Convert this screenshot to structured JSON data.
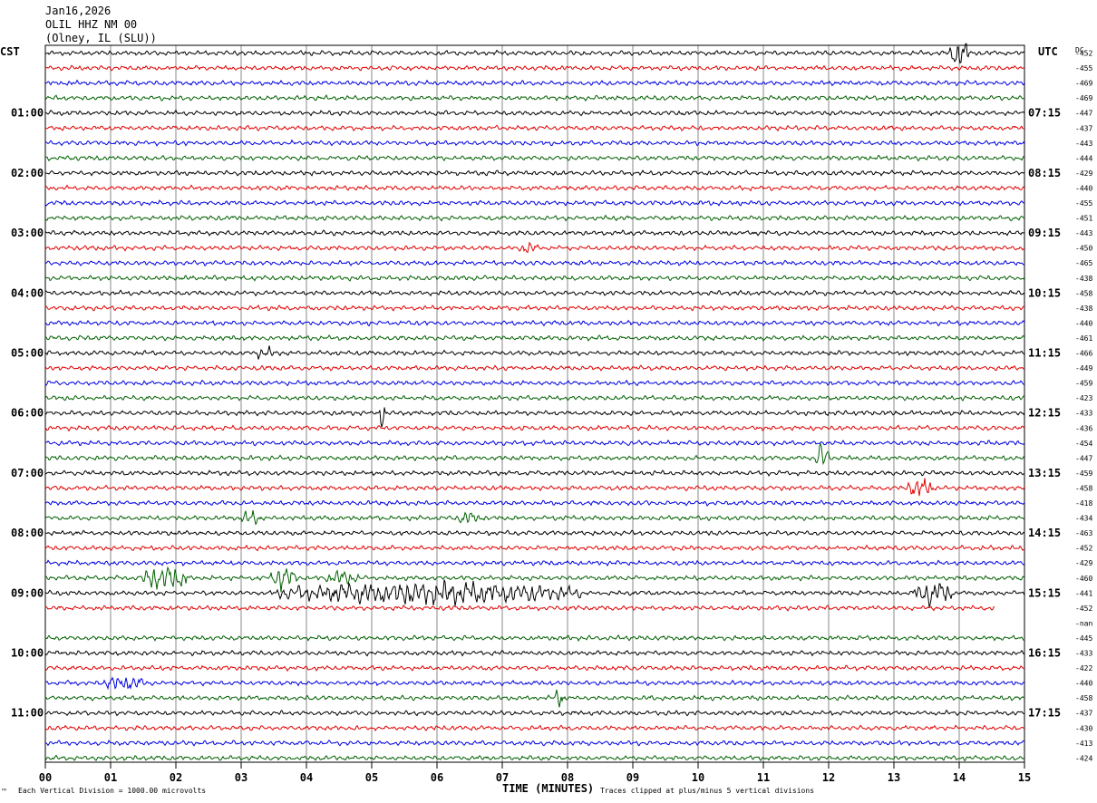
{
  "header": {
    "date": "Jan16,2026",
    "station": "OLIL HHZ NM 00",
    "location": "(Olney, IL (SLU))",
    "left_zone": "CST",
    "right_zone": "UTC",
    "dc_label": "DC"
  },
  "chart_data": {
    "type": "line",
    "title": "",
    "xlabel": "TIME (MINUTES)",
    "x_ticks": [
      "00",
      "01",
      "02",
      "03",
      "04",
      "05",
      "06",
      "07",
      "08",
      "09",
      "10",
      "11",
      "12",
      "13",
      "14",
      "15"
    ],
    "xlim": [
      0,
      15
    ],
    "trace_colors": [
      "#000000",
      "#e00000",
      "#0000e0",
      "#006000"
    ],
    "left_time_labels": [
      "01:00",
      "02:00",
      "03:00",
      "04:00",
      "05:00",
      "06:00",
      "07:00",
      "08:00",
      "09:00",
      "10:00",
      "11:00"
    ],
    "right_time_labels": [
      "07:15",
      "08:15",
      "09:15",
      "10:15",
      "11:15",
      "12:15",
      "13:15",
      "14:15",
      "15:15",
      "16:15",
      "17:15"
    ],
    "dc_offsets": [
      "-452",
      "-455",
      "-469",
      "-469",
      "-447",
      "-437",
      "-443",
      "-444",
      "-429",
      "-440",
      "-455",
      "-451",
      "-443",
      "-450",
      "-465",
      "-438",
      "-458",
      "-438",
      "-440",
      "-461",
      "-466",
      "-449",
      "-459",
      "-423",
      "-433",
      "-436",
      "-454",
      "-447",
      "-459",
      "-458",
      "-418",
      "-434",
      "-463",
      "-452",
      "-429",
      "-460",
      "-441",
      "-452",
      "-nan",
      "-445",
      "-433",
      "-422",
      "-440",
      "-458",
      "-437",
      "-430",
      "-413",
      "-424"
    ],
    "events": [
      {
        "row": 0,
        "start_min": 13.85,
        "end_min": 14.15,
        "amp": 3.0
      },
      {
        "row": 13,
        "start_min": 7.25,
        "end_min": 7.55,
        "amp": 1.3
      },
      {
        "row": 20,
        "start_min": 3.2,
        "end_min": 3.5,
        "amp": 1.4
      },
      {
        "row": 24,
        "start_min": 5.1,
        "end_min": 5.2,
        "amp": 3.4
      },
      {
        "row": 27,
        "start_min": 11.8,
        "end_min": 12.0,
        "amp": 3.4
      },
      {
        "row": 29,
        "start_min": 13.2,
        "end_min": 13.6,
        "amp": 2.2
      },
      {
        "row": 31,
        "start_min": 3.0,
        "end_min": 3.3,
        "amp": 1.4
      },
      {
        "row": 31,
        "start_min": 6.3,
        "end_min": 6.7,
        "amp": 1.3
      },
      {
        "row": 35,
        "start_min": 1.5,
        "end_min": 2.2,
        "amp": 2.5
      },
      {
        "row": 35,
        "start_min": 3.45,
        "end_min": 3.85,
        "amp": 2.5
      },
      {
        "row": 35,
        "start_min": 4.3,
        "end_min": 4.8,
        "amp": 1.5
      },
      {
        "row": 36,
        "start_min": 3.55,
        "end_min": 8.2,
        "amp": 2.2
      },
      {
        "row": 36,
        "start_min": 13.3,
        "end_min": 13.9,
        "amp": 2.6
      },
      {
        "row": 42,
        "start_min": 0.9,
        "end_min": 1.5,
        "amp": 1.6
      },
      {
        "row": 43,
        "start_min": 7.8,
        "end_min": 7.95,
        "amp": 2.0
      }
    ],
    "truncated_rows": [
      {
        "row": 37,
        "end_min": 14.55
      }
    ],
    "empty_rows": [
      38
    ]
  },
  "footer": {
    "scale_note": "Each Vertical Division = 1000.00 microvolts",
    "clip_note": "Traces clipped at plus/minus 5 vertical divisions",
    "logo_mark": "™"
  }
}
